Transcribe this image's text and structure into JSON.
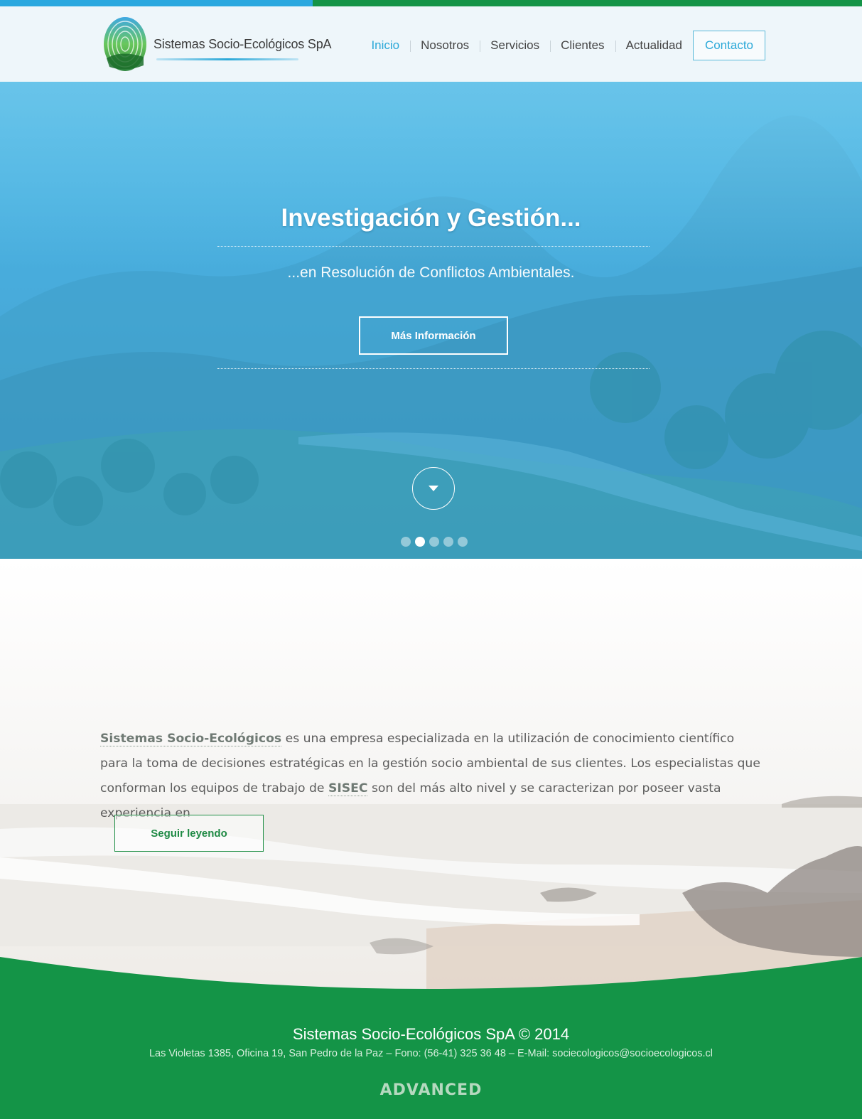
{
  "colors": {
    "topbar_blue": "#2aa8df",
    "topbar_green": "#149447",
    "accent_blue": "#2aa8d8",
    "footer_green": "#149447"
  },
  "header": {
    "logo_text": "Sistemas Socio-Ecológicos SpA",
    "nav": [
      {
        "label": "Inicio",
        "active": true
      },
      {
        "label": "Nosotros"
      },
      {
        "label": "Servicios"
      },
      {
        "label": "Clientes"
      },
      {
        "label": "Actualidad"
      }
    ],
    "contact_label": "Contacto"
  },
  "hero": {
    "title": "Investigación y Gestión...",
    "subtitle": "...en Resolución de Conflictos Ambientales.",
    "button_label": "Más Información",
    "slides_total": 5,
    "active_slide": 2
  },
  "about": {
    "highlight_company": "Sistemas Socio-Ecológicos",
    "text_1": " es una empresa especializada en la utilización de conocimiento científico para la toma de decisiones estratégicas en la gestión socio ambiental de sus clientes. Los especialistas que conforman los equipos de trabajo de ",
    "highlight_short": "SISEC",
    "text_2": " son del más alto nivel y se caracterizan por poseer vasta experiencia en",
    "button_label": "Seguir leyendo"
  },
  "footer": {
    "title": "Sistemas Socio-Ecológicos SpA  © 2014",
    "info": "Las Violetas 1385, Oficina 19, San Pedro de la Paz – Fono: (56-41) 325 36 48 – E-Mail: sociecologicos@socioecologicos.cl",
    "brand": "ADVANCED"
  }
}
